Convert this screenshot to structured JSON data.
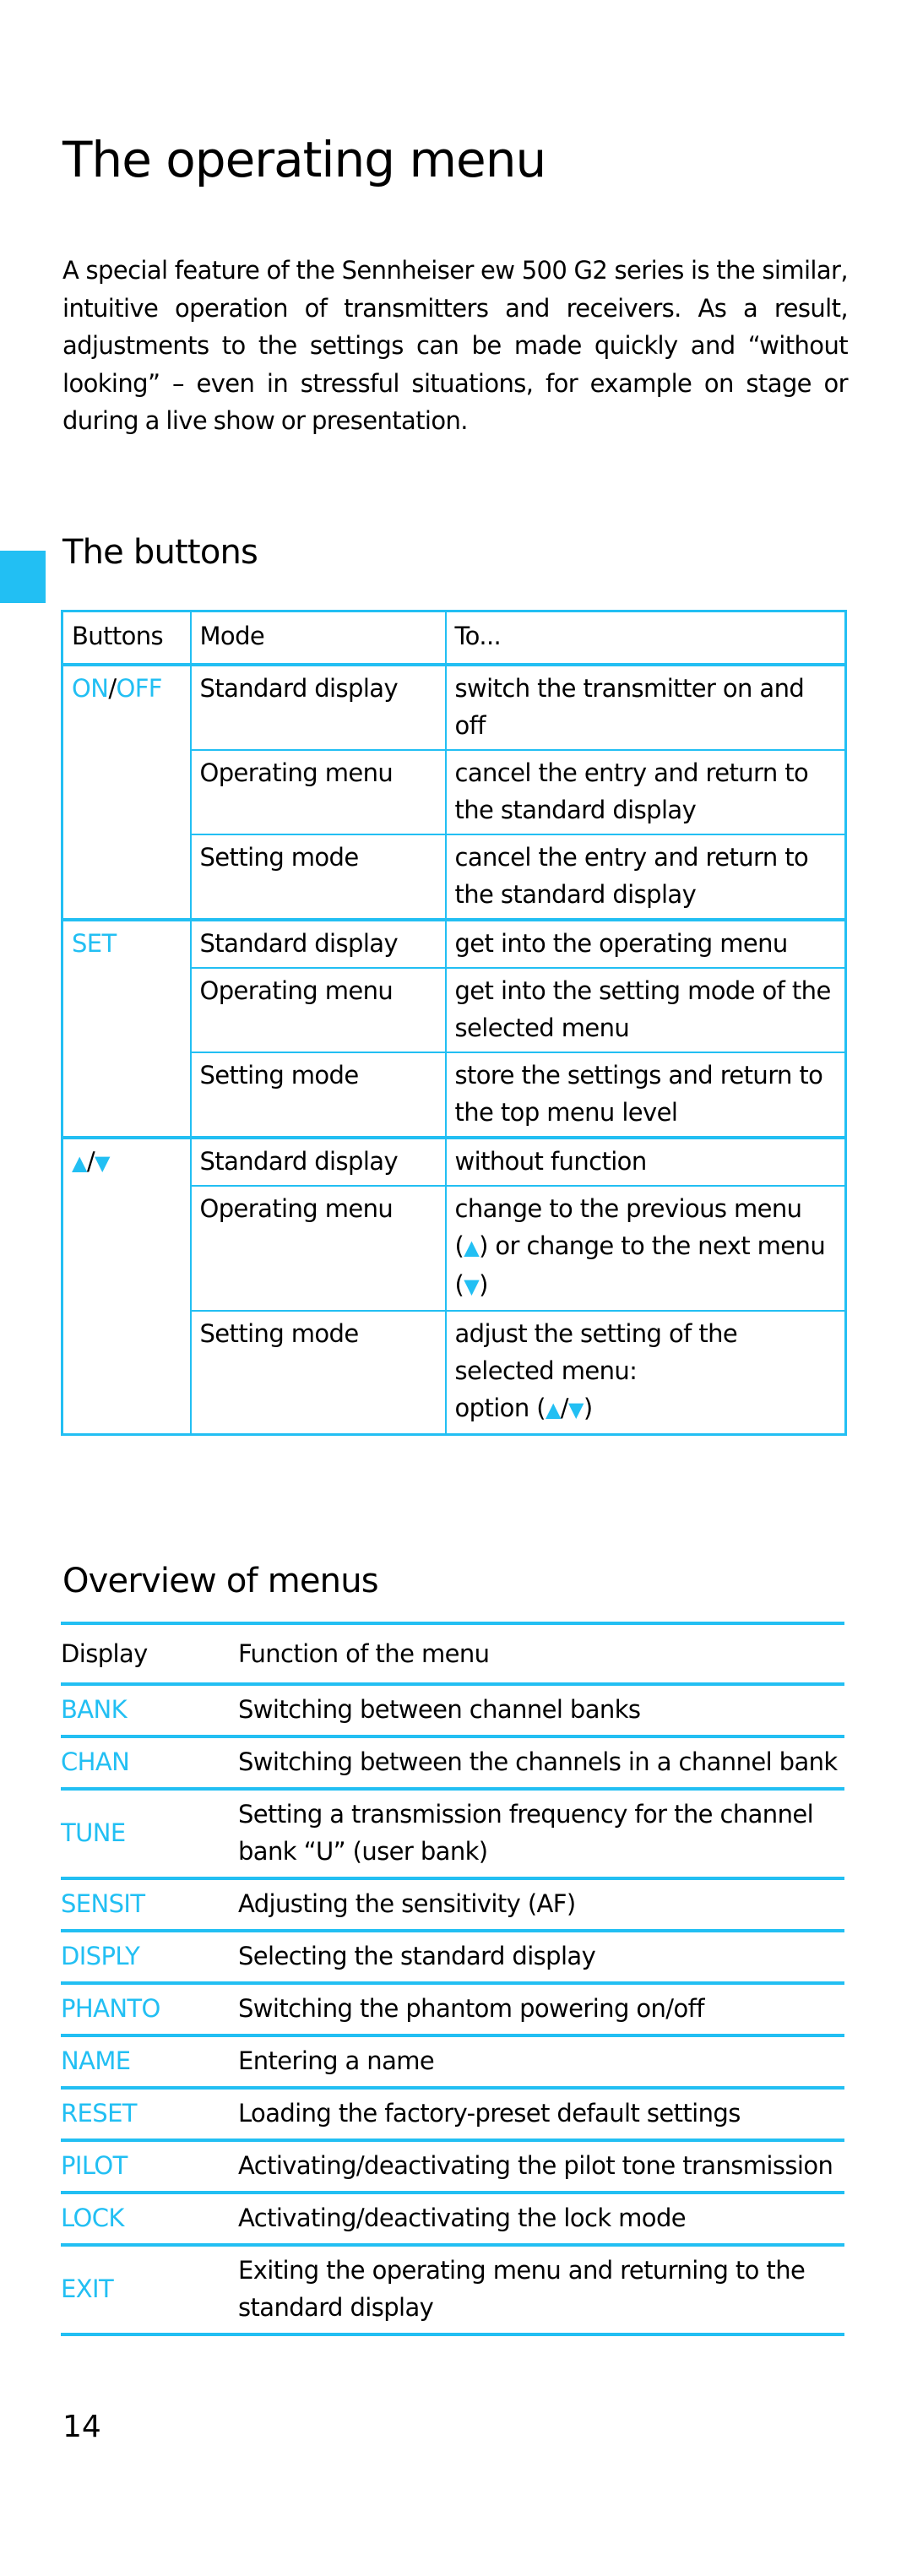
{
  "page": {
    "title": "The operating menu",
    "intro": "A special feature of the Sennheiser ew 500 G2 series is the similar, intuitive operation of transmitters and receivers. As a result, adjustments to the settings can be made quickly and “without looking” – even in stressful situations, for example on stage or during a live show or presentation.",
    "page_number": "14",
    "accent_color": "#22bff3"
  },
  "buttons_section": {
    "heading": "The buttons",
    "headers": [
      "Buttons",
      "Mode",
      "To..."
    ],
    "groups": [
      {
        "button_parts": [
          "ON",
          "/",
          "OFF"
        ],
        "rows": [
          {
            "mode": "Standard display",
            "action": "switch the transmitter on and off"
          },
          {
            "mode": "Operating menu",
            "action": "cancel the entry and return to the standard display"
          },
          {
            "mode": "Setting mode",
            "action": "cancel the entry and return to the standard display"
          }
        ]
      },
      {
        "button_parts": [
          "SET"
        ],
        "rows": [
          {
            "mode": "Standard display",
            "action": "get into the operating menu"
          },
          {
            "mode": "Operating menu",
            "action": "get into the setting mode of the selected menu"
          },
          {
            "mode": "Setting mode",
            "action": "store the settings and return to the top menu level"
          }
        ]
      },
      {
        "button_parts": [
          "▲",
          "/",
          "▼"
        ],
        "button_icons": [
          "up-arrow-icon",
          "down-arrow-icon"
        ],
        "rows": [
          {
            "mode": "Standard display",
            "action": "without function"
          },
          {
            "mode": "Operating menu",
            "action_parts": [
              "change to the previous menu (",
              "▲",
              ") or change to the next menu (",
              "▼",
              ")"
            ]
          },
          {
            "mode": "Setting mode",
            "action_parts": [
              "adjust the setting of the selected menu:",
              "option (",
              "▲",
              "/",
              "▼",
              ")"
            ]
          }
        ]
      }
    ]
  },
  "overview_section": {
    "heading": "Overview of menus",
    "headers": [
      "Display",
      "Function of the menu"
    ],
    "rows": [
      {
        "display": "BANK",
        "function": "Switching between channel banks"
      },
      {
        "display": "CHAN",
        "function": "Switching between the channels in a channel bank"
      },
      {
        "display": "TUNE",
        "function": "Setting a transmission frequency for the channel bank “U” (user bank)"
      },
      {
        "display": "SENSIT",
        "function": "Adjusting the sensitivity (AF)"
      },
      {
        "display": "DISPLY",
        "function": "Selecting the standard display"
      },
      {
        "display": "PHANTO",
        "function": "Switching the phantom powering on/off"
      },
      {
        "display": "NAME",
        "function": "Entering a name"
      },
      {
        "display": "RESET",
        "function": "Loading the factory-preset default settings"
      },
      {
        "display": "PILOT",
        "function": "Activating/deactivating the pilot tone transmission"
      },
      {
        "display": "LOCK",
        "function": "Activating/deactivating the lock mode"
      },
      {
        "display": "EXIT",
        "function": "Exiting the operating menu and returning to the standard display"
      }
    ]
  }
}
